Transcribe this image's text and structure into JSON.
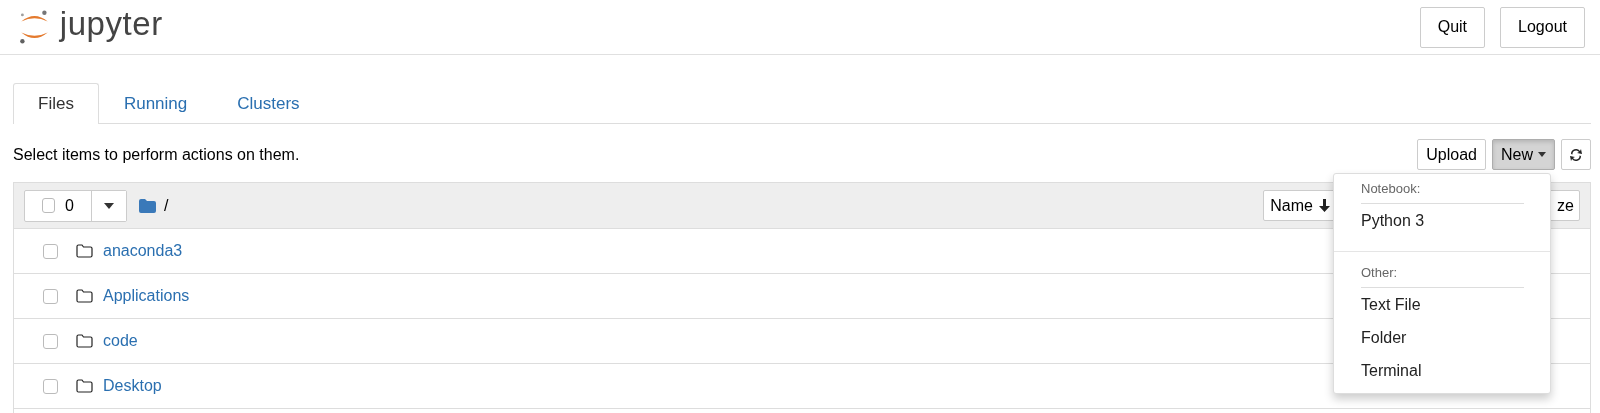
{
  "header": {
    "logo_text": "jupyter",
    "buttons": [
      "Quit",
      "Logout"
    ]
  },
  "tabs": [
    {
      "label": "Files",
      "selected": true
    },
    {
      "label": "Running",
      "selected": false
    },
    {
      "label": "Clusters",
      "selected": false
    }
  ],
  "instructions": "Select items to perform actions on them.",
  "toolbar": {
    "upload": "Upload",
    "new": "New",
    "new_open": true
  },
  "list_header": {
    "selected_count": "0",
    "all_checked": false,
    "path": "/",
    "sort_buttons": [
      {
        "label": "Name",
        "kind": "sort"
      },
      {
        "label": "ze",
        "kind": "plain"
      }
    ]
  },
  "rows": [
    {
      "name": "anaconda3",
      "kind": "folder",
      "checked": false
    },
    {
      "name": "Applications",
      "kind": "folder",
      "checked": false
    },
    {
      "name": "code",
      "kind": "folder",
      "checked": false
    },
    {
      "name": "Desktop",
      "kind": "folder",
      "checked": false
    }
  ],
  "new_menu": {
    "sections": [
      {
        "header": "Notebook:",
        "items": [
          "Python 3"
        ]
      },
      {
        "header": "Other:",
        "items": [
          "Text File",
          "Folder",
          "Terminal"
        ]
      }
    ]
  }
}
